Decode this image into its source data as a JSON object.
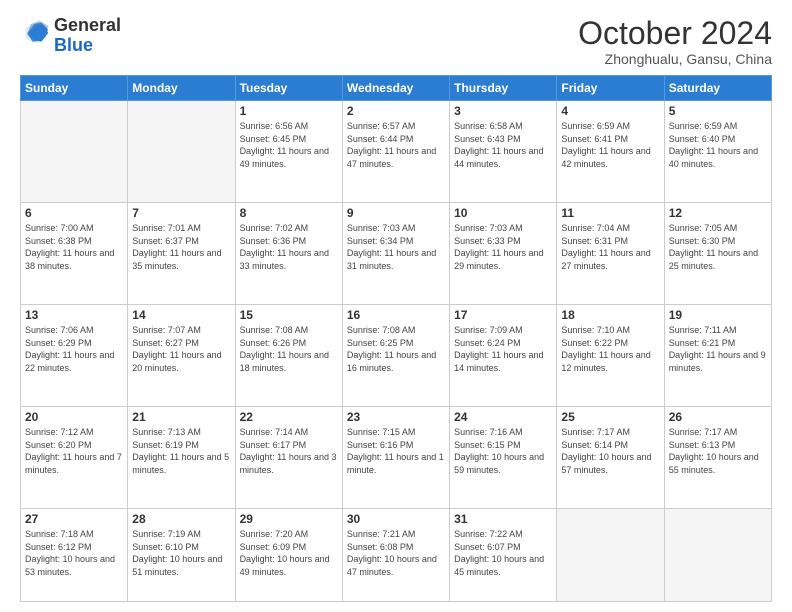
{
  "logo": {
    "general": "General",
    "blue": "Blue"
  },
  "header": {
    "month": "October 2024",
    "location": "Zhonghualu, Gansu, China"
  },
  "weekdays": [
    "Sunday",
    "Monday",
    "Tuesday",
    "Wednesday",
    "Thursday",
    "Friday",
    "Saturday"
  ],
  "weeks": [
    [
      {
        "day": "",
        "sunrise": "",
        "sunset": "",
        "daylight": ""
      },
      {
        "day": "",
        "sunrise": "",
        "sunset": "",
        "daylight": ""
      },
      {
        "day": "1",
        "sunrise": "Sunrise: 6:56 AM",
        "sunset": "Sunset: 6:45 PM",
        "daylight": "Daylight: 11 hours and 49 minutes."
      },
      {
        "day": "2",
        "sunrise": "Sunrise: 6:57 AM",
        "sunset": "Sunset: 6:44 PM",
        "daylight": "Daylight: 11 hours and 47 minutes."
      },
      {
        "day": "3",
        "sunrise": "Sunrise: 6:58 AM",
        "sunset": "Sunset: 6:43 PM",
        "daylight": "Daylight: 11 hours and 44 minutes."
      },
      {
        "day": "4",
        "sunrise": "Sunrise: 6:59 AM",
        "sunset": "Sunset: 6:41 PM",
        "daylight": "Daylight: 11 hours and 42 minutes."
      },
      {
        "day": "5",
        "sunrise": "Sunrise: 6:59 AM",
        "sunset": "Sunset: 6:40 PM",
        "daylight": "Daylight: 11 hours and 40 minutes."
      }
    ],
    [
      {
        "day": "6",
        "sunrise": "Sunrise: 7:00 AM",
        "sunset": "Sunset: 6:38 PM",
        "daylight": "Daylight: 11 hours and 38 minutes."
      },
      {
        "day": "7",
        "sunrise": "Sunrise: 7:01 AM",
        "sunset": "Sunset: 6:37 PM",
        "daylight": "Daylight: 11 hours and 35 minutes."
      },
      {
        "day": "8",
        "sunrise": "Sunrise: 7:02 AM",
        "sunset": "Sunset: 6:36 PM",
        "daylight": "Daylight: 11 hours and 33 minutes."
      },
      {
        "day": "9",
        "sunrise": "Sunrise: 7:03 AM",
        "sunset": "Sunset: 6:34 PM",
        "daylight": "Daylight: 11 hours and 31 minutes."
      },
      {
        "day": "10",
        "sunrise": "Sunrise: 7:03 AM",
        "sunset": "Sunset: 6:33 PM",
        "daylight": "Daylight: 11 hours and 29 minutes."
      },
      {
        "day": "11",
        "sunrise": "Sunrise: 7:04 AM",
        "sunset": "Sunset: 6:31 PM",
        "daylight": "Daylight: 11 hours and 27 minutes."
      },
      {
        "day": "12",
        "sunrise": "Sunrise: 7:05 AM",
        "sunset": "Sunset: 6:30 PM",
        "daylight": "Daylight: 11 hours and 25 minutes."
      }
    ],
    [
      {
        "day": "13",
        "sunrise": "Sunrise: 7:06 AM",
        "sunset": "Sunset: 6:29 PM",
        "daylight": "Daylight: 11 hours and 22 minutes."
      },
      {
        "day": "14",
        "sunrise": "Sunrise: 7:07 AM",
        "sunset": "Sunset: 6:27 PM",
        "daylight": "Daylight: 11 hours and 20 minutes."
      },
      {
        "day": "15",
        "sunrise": "Sunrise: 7:08 AM",
        "sunset": "Sunset: 6:26 PM",
        "daylight": "Daylight: 11 hours and 18 minutes."
      },
      {
        "day": "16",
        "sunrise": "Sunrise: 7:08 AM",
        "sunset": "Sunset: 6:25 PM",
        "daylight": "Daylight: 11 hours and 16 minutes."
      },
      {
        "day": "17",
        "sunrise": "Sunrise: 7:09 AM",
        "sunset": "Sunset: 6:24 PM",
        "daylight": "Daylight: 11 hours and 14 minutes."
      },
      {
        "day": "18",
        "sunrise": "Sunrise: 7:10 AM",
        "sunset": "Sunset: 6:22 PM",
        "daylight": "Daylight: 11 hours and 12 minutes."
      },
      {
        "day": "19",
        "sunrise": "Sunrise: 7:11 AM",
        "sunset": "Sunset: 6:21 PM",
        "daylight": "Daylight: 11 hours and 9 minutes."
      }
    ],
    [
      {
        "day": "20",
        "sunrise": "Sunrise: 7:12 AM",
        "sunset": "Sunset: 6:20 PM",
        "daylight": "Daylight: 11 hours and 7 minutes."
      },
      {
        "day": "21",
        "sunrise": "Sunrise: 7:13 AM",
        "sunset": "Sunset: 6:19 PM",
        "daylight": "Daylight: 11 hours and 5 minutes."
      },
      {
        "day": "22",
        "sunrise": "Sunrise: 7:14 AM",
        "sunset": "Sunset: 6:17 PM",
        "daylight": "Daylight: 11 hours and 3 minutes."
      },
      {
        "day": "23",
        "sunrise": "Sunrise: 7:15 AM",
        "sunset": "Sunset: 6:16 PM",
        "daylight": "Daylight: 11 hours and 1 minute."
      },
      {
        "day": "24",
        "sunrise": "Sunrise: 7:16 AM",
        "sunset": "Sunset: 6:15 PM",
        "daylight": "Daylight: 10 hours and 59 minutes."
      },
      {
        "day": "25",
        "sunrise": "Sunrise: 7:17 AM",
        "sunset": "Sunset: 6:14 PM",
        "daylight": "Daylight: 10 hours and 57 minutes."
      },
      {
        "day": "26",
        "sunrise": "Sunrise: 7:17 AM",
        "sunset": "Sunset: 6:13 PM",
        "daylight": "Daylight: 10 hours and 55 minutes."
      }
    ],
    [
      {
        "day": "27",
        "sunrise": "Sunrise: 7:18 AM",
        "sunset": "Sunset: 6:12 PM",
        "daylight": "Daylight: 10 hours and 53 minutes."
      },
      {
        "day": "28",
        "sunrise": "Sunrise: 7:19 AM",
        "sunset": "Sunset: 6:10 PM",
        "daylight": "Daylight: 10 hours and 51 minutes."
      },
      {
        "day": "29",
        "sunrise": "Sunrise: 7:20 AM",
        "sunset": "Sunset: 6:09 PM",
        "daylight": "Daylight: 10 hours and 49 minutes."
      },
      {
        "day": "30",
        "sunrise": "Sunrise: 7:21 AM",
        "sunset": "Sunset: 6:08 PM",
        "daylight": "Daylight: 10 hours and 47 minutes."
      },
      {
        "day": "31",
        "sunrise": "Sunrise: 7:22 AM",
        "sunset": "Sunset: 6:07 PM",
        "daylight": "Daylight: 10 hours and 45 minutes."
      },
      {
        "day": "",
        "sunrise": "",
        "sunset": "",
        "daylight": ""
      },
      {
        "day": "",
        "sunrise": "",
        "sunset": "",
        "daylight": ""
      }
    ]
  ]
}
